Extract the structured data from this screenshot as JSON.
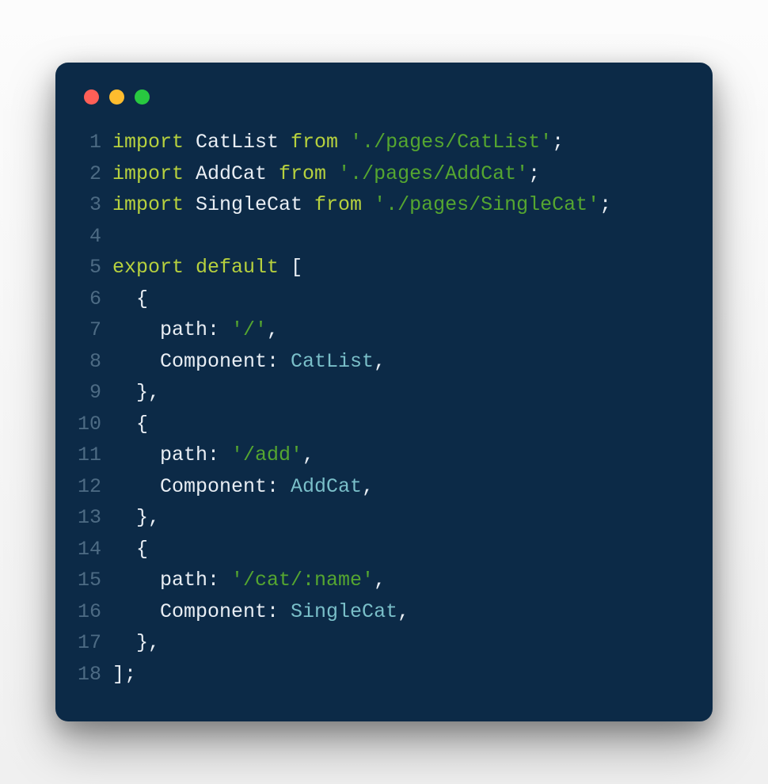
{
  "window": {
    "traffic_lights": [
      "close",
      "minimize",
      "zoom"
    ]
  },
  "code": {
    "lines": [
      {
        "n": "1",
        "tokens": [
          {
            "c": "kw",
            "t": "import"
          },
          {
            "c": "id",
            "t": " CatList "
          },
          {
            "c": "kw",
            "t": "from"
          },
          {
            "c": "id",
            "t": " "
          },
          {
            "c": "str",
            "t": "'./pages/CatList'"
          },
          {
            "c": "id",
            "t": ";"
          }
        ]
      },
      {
        "n": "2",
        "tokens": [
          {
            "c": "kw",
            "t": "import"
          },
          {
            "c": "id",
            "t": " AddCat "
          },
          {
            "c": "kw",
            "t": "from"
          },
          {
            "c": "id",
            "t": " "
          },
          {
            "c": "str",
            "t": "'./pages/AddCat'"
          },
          {
            "c": "id",
            "t": ";"
          }
        ]
      },
      {
        "n": "3",
        "tokens": [
          {
            "c": "kw",
            "t": "import"
          },
          {
            "c": "id",
            "t": " SingleCat "
          },
          {
            "c": "kw",
            "t": "from"
          },
          {
            "c": "id",
            "t": " "
          },
          {
            "c": "str",
            "t": "'./pages/SingleCat'"
          },
          {
            "c": "id",
            "t": ";"
          }
        ]
      },
      {
        "n": "4",
        "tokens": [
          {
            "c": "id",
            "t": ""
          }
        ]
      },
      {
        "n": "5",
        "tokens": [
          {
            "c": "kw",
            "t": "export"
          },
          {
            "c": "id",
            "t": " "
          },
          {
            "c": "kw",
            "t": "default"
          },
          {
            "c": "id",
            "t": " ["
          }
        ]
      },
      {
        "n": "6",
        "tokens": [
          {
            "c": "id",
            "t": "  {"
          }
        ]
      },
      {
        "n": "7",
        "tokens": [
          {
            "c": "id",
            "t": "    path: "
          },
          {
            "c": "str",
            "t": "'/'"
          },
          {
            "c": "id",
            "t": ","
          }
        ]
      },
      {
        "n": "8",
        "tokens": [
          {
            "c": "id",
            "t": "    Component: "
          },
          {
            "c": "cls",
            "t": "CatList"
          },
          {
            "c": "id",
            "t": ","
          }
        ]
      },
      {
        "n": "9",
        "tokens": [
          {
            "c": "id",
            "t": "  },"
          }
        ]
      },
      {
        "n": "10",
        "tokens": [
          {
            "c": "id",
            "t": "  {"
          }
        ]
      },
      {
        "n": "11",
        "tokens": [
          {
            "c": "id",
            "t": "    path: "
          },
          {
            "c": "str",
            "t": "'/add'"
          },
          {
            "c": "id",
            "t": ","
          }
        ]
      },
      {
        "n": "12",
        "tokens": [
          {
            "c": "id",
            "t": "    Component: "
          },
          {
            "c": "cls",
            "t": "AddCat"
          },
          {
            "c": "id",
            "t": ","
          }
        ]
      },
      {
        "n": "13",
        "tokens": [
          {
            "c": "id",
            "t": "  },"
          }
        ]
      },
      {
        "n": "14",
        "tokens": [
          {
            "c": "id",
            "t": "  {"
          }
        ]
      },
      {
        "n": "15",
        "tokens": [
          {
            "c": "id",
            "t": "    path: "
          },
          {
            "c": "str",
            "t": "'/cat/:name'"
          },
          {
            "c": "id",
            "t": ","
          }
        ]
      },
      {
        "n": "16",
        "tokens": [
          {
            "c": "id",
            "t": "    Component: "
          },
          {
            "c": "cls",
            "t": "SingleCat"
          },
          {
            "c": "id",
            "t": ","
          }
        ]
      },
      {
        "n": "17",
        "tokens": [
          {
            "c": "id",
            "t": "  },"
          }
        ]
      },
      {
        "n": "18",
        "tokens": [
          {
            "c": "id",
            "t": "];"
          }
        ]
      }
    ]
  }
}
